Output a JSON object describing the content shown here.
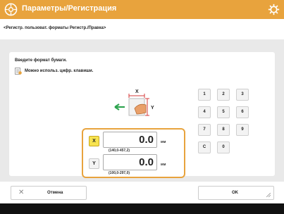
{
  "title": "Параметры/Регистрация",
  "breadcrumb": "<Регистр. пользоват. форматы Регистр./Правка>",
  "instruction": "Введите формат бумаги.",
  "info_note": "Можно использ. цифр. клавиши.",
  "x_field": {
    "label": "X",
    "value": "0.0",
    "unit": "мм",
    "range": "(140,0-457,2)"
  },
  "y_field": {
    "label": "Y",
    "value": "0.0",
    "unit": "мм",
    "range": "(100,0-297,0)"
  },
  "keypad": {
    "keys": [
      "1",
      "2",
      "3",
      "4",
      "5",
      "6",
      "7",
      "8",
      "9",
      "C",
      "0"
    ]
  },
  "buttons": {
    "cancel": "Отмена",
    "ok": "OK"
  },
  "colors": {
    "accent": "#e8a33d",
    "active_axis": "#f7e34f"
  },
  "icons": {
    "title": "settings-registration-icon",
    "gear": "gear-icon",
    "info": "info-icon",
    "cancel": "close-icon"
  }
}
